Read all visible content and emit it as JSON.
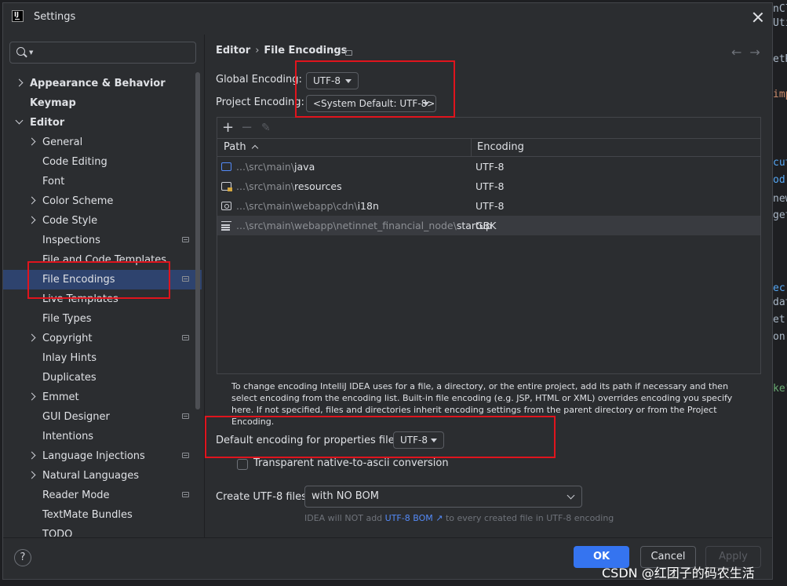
{
  "window": {
    "title": "Settings"
  },
  "search": {
    "placeholder": ""
  },
  "sidebar": {
    "items": [
      {
        "label": "Appearance & Behavior",
        "level": 0,
        "bold": true,
        "expand": "collapsed"
      },
      {
        "label": "Keymap",
        "level": 0,
        "bold": true
      },
      {
        "label": "Editor",
        "level": 0,
        "bold": true,
        "expand": "expanded"
      },
      {
        "label": "General",
        "level": 1,
        "expand": "collapsed"
      },
      {
        "label": "Code Editing",
        "level": 1
      },
      {
        "label": "Font",
        "level": 1
      },
      {
        "label": "Color Scheme",
        "level": 1,
        "expand": "collapsed"
      },
      {
        "label": "Code Style",
        "level": 1,
        "expand": "collapsed"
      },
      {
        "label": "Inspections",
        "level": 1,
        "project": true
      },
      {
        "label": "File and Code Templates",
        "level": 1
      },
      {
        "label": "File Encodings",
        "level": 1,
        "project": true,
        "selected": true
      },
      {
        "label": "Live Templates",
        "level": 1
      },
      {
        "label": "File Types",
        "level": 1
      },
      {
        "label": "Copyright",
        "level": 1,
        "expand": "collapsed",
        "project": true
      },
      {
        "label": "Inlay Hints",
        "level": 1
      },
      {
        "label": "Duplicates",
        "level": 1
      },
      {
        "label": "Emmet",
        "level": 1,
        "expand": "collapsed"
      },
      {
        "label": "GUI Designer",
        "level": 1,
        "project": true
      },
      {
        "label": "Intentions",
        "level": 1
      },
      {
        "label": "Language Injections",
        "level": 1,
        "expand": "collapsed",
        "project": true
      },
      {
        "label": "Natural Languages",
        "level": 1,
        "expand": "collapsed"
      },
      {
        "label": "Reader Mode",
        "level": 1,
        "project": true
      },
      {
        "label": "TextMate Bundles",
        "level": 1
      },
      {
        "label": "TODO",
        "level": 1
      }
    ]
  },
  "breadcrumb": {
    "parent": "Editor",
    "current": "File Encodings"
  },
  "global_encoding": {
    "label": "Global Encoding:",
    "value": "UTF-8"
  },
  "project_encoding": {
    "label": "Project Encoding:",
    "value": "<System Default: UTF-8>"
  },
  "table": {
    "columns": {
      "path": "Path",
      "encoding": "Encoding"
    },
    "rows": [
      {
        "icon": "folder-icon",
        "prefix": "...\\src\\main\\",
        "name": "java",
        "encoding": "UTF-8"
      },
      {
        "icon": "resources-folder-icon",
        "prefix": "...\\src\\main\\",
        "name": "resources",
        "encoding": "UTF-8"
      },
      {
        "icon": "web-folder-icon",
        "prefix": "...\\src\\main\\webapp\\cdn\\",
        "name": "i18n",
        "encoding": "UTF-8"
      },
      {
        "icon": "text-file-icon",
        "prefix": "...\\src\\main\\webapp\\netinnet_financial_node\\",
        "name": "startup",
        "encoding": "GBK",
        "highlighted": true
      }
    ]
  },
  "help_text": "To change encoding IntelliJ IDEA uses for a file, a directory, or the entire project, add its path if necessary and then select encoding from the encoding list. Built-in file encoding (e.g. JSP, HTML or XML) overrides encoding you specify here. If not specified, files and directories inherit encoding settings from the parent directory or from the Project Encoding.",
  "properties": {
    "label": "Default encoding for properties files:",
    "value": "UTF-8"
  },
  "native_to_ascii": {
    "label": "Transparent native-to-ascii conversion",
    "checked": false
  },
  "bom": {
    "label": "Create UTF-8 files:",
    "value": "with NO BOM",
    "note_before": "IDEA will NOT add",
    "note_link": "UTF-8 BOM ↗",
    "note_after": "to every created file in UTF-8 encoding"
  },
  "buttons": {
    "ok": "OK",
    "cancel": "Cancel",
    "apply": "Apply",
    "help": "?"
  },
  "watermark": "CSDN @红团子的码农生活",
  "colors": {
    "accent": "#3574f0",
    "selection": "#2e436e",
    "highlight_box": "#e0141d",
    "link": "#548af7"
  }
}
